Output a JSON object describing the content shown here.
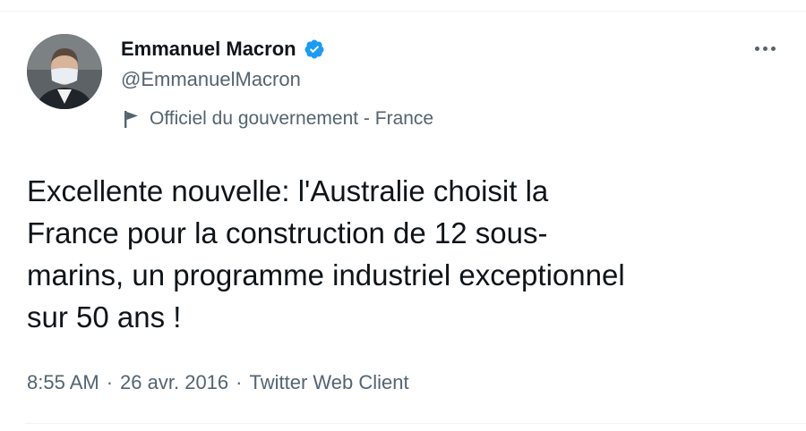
{
  "author": {
    "display_name": "Emmanuel Macron",
    "handle": "@EmmanuelMacron",
    "verified": true,
    "avatar_icon": "profile-photo"
  },
  "affiliation": {
    "label": "Officiel du gouvernement - France",
    "icon": "flag-icon"
  },
  "tweet": {
    "text": "Excellente nouvelle: l'Australie choisit la\nFrance pour la construction de 12 sous-\nmarins, un programme industriel exceptionnel\nsur 50 ans !"
  },
  "meta": {
    "time": "8:55 AM",
    "separator": "·",
    "date": "26 avr. 2016",
    "source": "Twitter Web Client"
  },
  "colors": {
    "verified_blue": "#1d9bf0",
    "text_primary": "#0f1419",
    "text_secondary": "#536471",
    "divider": "#eff3f4"
  }
}
